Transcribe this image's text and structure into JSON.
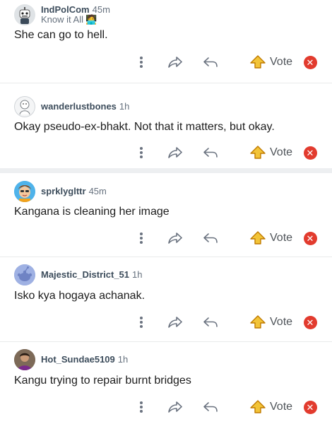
{
  "colors": {
    "upvote_fill": "#f2c438",
    "upvote_stroke": "#c07a00",
    "downvote_bg": "#e23b2e",
    "username": "#3d4d5c",
    "meta": "#66717e"
  },
  "actions": {
    "vote_label": "Vote",
    "more_icon": "more-vertical-icon",
    "share_icon": "share-arrow-icon",
    "reply_icon": "reply-arrow-icon",
    "upvote_icon": "upvote-arrow-icon",
    "downvote_icon": "downvote-x-icon"
  },
  "comments": [
    {
      "username": "IndPolCom",
      "time": "45m",
      "flair": "Know it All",
      "flair_emoji": "🧑‍💻",
      "body": "She can go to hell.",
      "avatar": "robot-avatar"
    },
    {
      "username": "wanderlustbones",
      "time": "1h",
      "flair": "",
      "body": "Okay pseudo-ex-bhakt. Not that it matters, but okay.",
      "avatar": "sketch-avatar"
    },
    {
      "username": "sprklyglttr",
      "time": "45m",
      "body": "Kangana is cleaning her image",
      "avatar": "colorful-avatar"
    },
    {
      "username": "Majestic_District_51",
      "time": "1h",
      "body": "Isko kya hogaya achanak.",
      "avatar": "snoo-default-avatar"
    },
    {
      "username": "Hot_Sundae5109",
      "time": "1h",
      "body": "Kangu trying to repair burnt bridges",
      "avatar": "photo-avatar"
    }
  ]
}
